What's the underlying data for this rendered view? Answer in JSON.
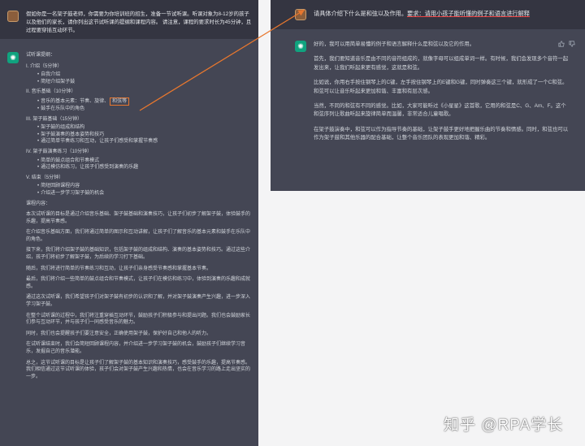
{
  "left_panel": {
    "user_message": "假如你是一名架子鼓老师，你需要为你培训班的招生，准备一节试听课。听课对象为8-12岁的孩子以及他们的家长，请你列出这节试听课的提纲和课程内容。 请注意，课程的要求时长为45分钟，且过程要穿插互动环节。",
    "outline_title": "试听课提纲：",
    "sections": [
      {
        "heading": "I. 介绍（5分钟）",
        "items": [
          "自我介绍",
          "简短介绍架子鼓"
        ]
      },
      {
        "heading": "II. 音乐基础（10分钟）",
        "items": [
          "音乐的基本元素：节奏、旋律、",
          "鼓手在乐队中的角色"
        ],
        "highlight": "和弦等"
      },
      {
        "heading": "III. 架子鼓基础（15分钟）",
        "items": [
          "架子鼓的组成和结构",
          "架子鼓演奏的基本姿势和技巧",
          "通过简单节奏练习和互动，让孩子们感受和掌握节奏感"
        ]
      },
      {
        "heading": "IV. 架子鼓演奏练习（10分钟）",
        "items": [
          "简单的鼓点组合和节奏模式",
          "通过模仿和练习，让孩子们感受到演奏的乐趣"
        ]
      },
      {
        "heading": "V. 结束（5分钟）",
        "items": [
          "简短回顾课程内容",
          "介绍进一步学习架子鼓的机会"
        ]
      }
    ],
    "content_title": "课程内容：",
    "paragraphs": [
      "本次试听课的目标是通过介绍音乐基础、架子鼓基础和演奏技巧，让孩子们初步了解架子鼓，体验鼓手的乐趣，提高节奏感。",
      "在介绍音乐基础方面，我们将通过简单的图示和互动讲解，让孩子们了解音乐的基本元素和鼓手在乐队中的角色。",
      "接下来，我们将介绍架子鼓的基础知识，包括架子鼓的组成和结构、演奏的基本姿势和技巧。通过这些介绍，孩子们将初步了解架子鼓，为后续的学习打下基础。",
      "随后，我们将进行简单的节奏练习和互动，让孩子们亲身感受节奏感和掌握基本节奏。",
      "最后，我们将介绍一些简单的鼓点组合和节奏模式，让孩子们在模仿和练习中，体验到演奏的乐趣和成就感。",
      "通过这次试听课，我们希望孩子们对架子鼓有初步的认识和了解，并对架子鼓演奏产生兴趣，进一步深入学习架子鼓。",
      "在整个试听课的过程中，我们将注重穿插互动环节，鼓励孩子们积极参与和提出问题。我们也会鼓励家长们参与互动环节，并与孩子们一同感受音乐的魅力。",
      "同时，我们也会提醒孩子们要注意安全，正确使用架子鼓，保护好自己和他人的听力。",
      "在试听课结束时，我们会简短回顾课程内容，并介绍进一步学习架子鼓的机会，鼓励孩子们继续学习音乐，发掘自己的音乐潜能。",
      "总之，这节试听课的目标是让孩子们了解架子鼓的基本知识和演奏技巧，感受鼓手的乐趣，提高节奏感。我们相信通过这节试听课的体验，孩子们会对架子鼓产生兴趣和热情，也会在音乐学习的路上走出坚实的一步。"
    ]
  },
  "right_panel": {
    "user_message_plain": "请具体介绍下什么是和弦以及作用。",
    "user_message_req": "要求：请用小孩子能听懂的例子和语言进行解释",
    "paragraphs": [
      "好的，我可以用简单易懂的例子和语言解释什么是和弦以及它的作用。",
      "首先，我们要知道音乐是由不同的音符组成的，就像字母可以组成单词一样。有时候，我们会发现多个音符一起发出来，让我们听起来更有感觉，这就是和弦。",
      "比如说，你用右手按住钢琴上的C键，左手按住钢琴上的E键和G键，同时弹奏这三个键，就形成了一个C和弦。和弦可以让音乐听起来更加和谐、丰富和有层次感。",
      "当然，不同的和弦有不同的感觉。比如，大家可能听过《小星星》这首歌，它用的和弦是C、G、Am、F。这个和弦序列让歌曲听起来旋律简单而温馨，非常适合儿童唱歌。",
      "在架子鼓演奏中，和弦可以作为指导节奏的基础，让架子鼓手更好地把握乐曲的节奏和情感。同时，和弦也可以作为架子鼓和其他乐器的配合基础，让整个音乐团队的表现更加和谐、精彩。"
    ],
    "icons": [
      "thumbs-up-icon",
      "thumbs-down-icon"
    ]
  },
  "watermark": "知乎 @RPA学长",
  "colors": {
    "panel_bg": "#444654",
    "user_row_bg": "#343541",
    "accent_green": "#10a37f",
    "highlight_orange": "#e8772e",
    "underline_red": "#ef4444",
    "page_bg": "#f4f4f5"
  }
}
